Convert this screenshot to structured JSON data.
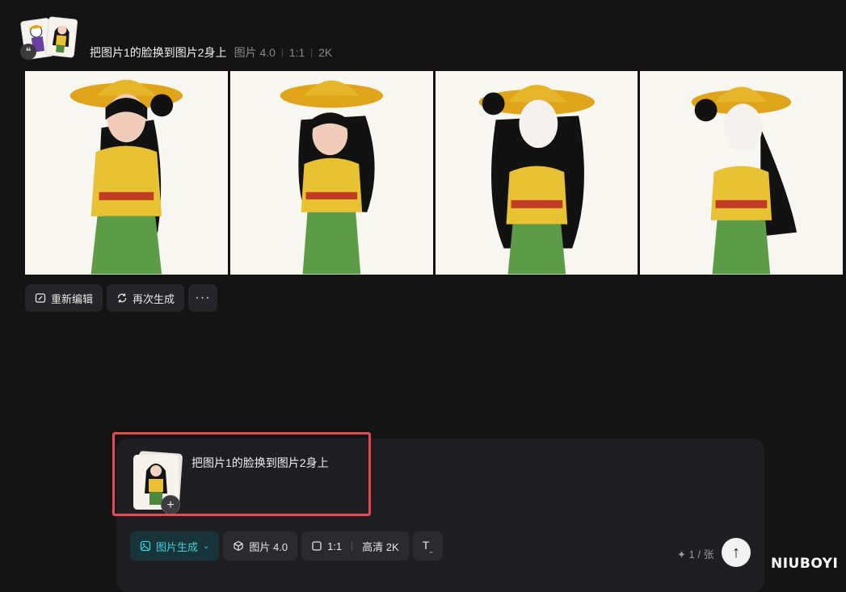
{
  "header": {
    "prompt": "把图片1的脸换到图片2身上",
    "model": "图片 4.0",
    "ratio": "1:1",
    "resolution": "2K",
    "badge_icon": "quote-icon"
  },
  "images": [
    {
      "label": "generated-image-1"
    },
    {
      "label": "generated-image-2"
    },
    {
      "label": "generated-image-3"
    },
    {
      "label": "generated-image-4"
    }
  ],
  "actions": {
    "reedit": "重新编辑",
    "regenerate": "再次生成",
    "more": "···"
  },
  "composer": {
    "prompt_text": "把图片1的脸换到图片2身上",
    "add_symbol": "+",
    "mode": "图片生成",
    "model": "图片 4.0",
    "ratio": "1:1",
    "quality": "高清 2K",
    "quota": "✦ 1 / 张",
    "send_symbol": "↑"
  },
  "colors": {
    "background": "#141414",
    "accent": "#3fd0d9",
    "highlight": "#e94a4e"
  },
  "watermark": "NIUBOYI"
}
